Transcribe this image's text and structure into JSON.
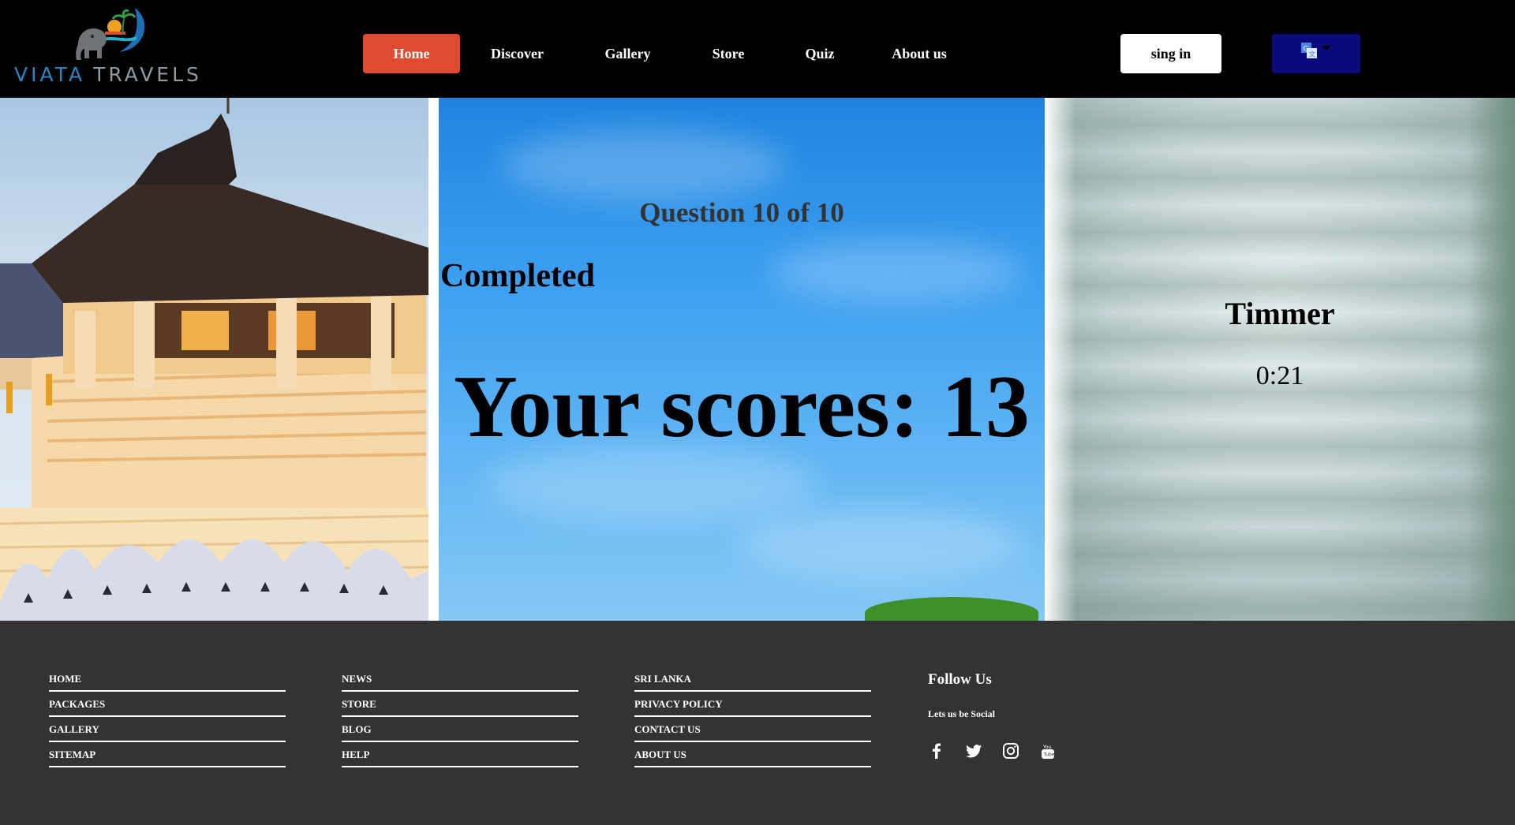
{
  "logo": {
    "word1": "VIATA",
    "word2": "TRAVELS"
  },
  "nav": {
    "items": [
      {
        "label": "Home",
        "active": true
      },
      {
        "label": "Discover",
        "active": false
      },
      {
        "label": "Gallery",
        "active": false
      },
      {
        "label": "Store",
        "active": false
      },
      {
        "label": "Quiz",
        "active": false
      },
      {
        "label": "About us",
        "active": false
      }
    ],
    "signin_label": "sing in",
    "translate_icon": "translate-icon"
  },
  "quiz": {
    "question_counter": "Question 10 of 10",
    "status": "Completed",
    "score_text": "Your scores: 13"
  },
  "timer": {
    "title": "Timmer",
    "value": "0:21"
  },
  "footer": {
    "columns": [
      {
        "links": [
          "HOME",
          "PACKAGES",
          "GALLERY",
          "SITEMAP"
        ]
      },
      {
        "links": [
          "NEWS",
          "STORE",
          "BLOG",
          "HELP"
        ]
      },
      {
        "links": [
          "SRI LANKA",
          "PRIVACY POLICY",
          "CONTACT US",
          "ABOUT US"
        ]
      }
    ],
    "follow_title": "Follow Us",
    "follow_subtitle": "Lets us be Social",
    "social_icons": [
      "facebook-icon",
      "twitter-icon",
      "instagram-icon",
      "youtube-icon"
    ]
  },
  "colors": {
    "header_bg": "#000000",
    "nav_active": "#e04a33",
    "translate_bg": "#0a0a7a",
    "footer_bg": "#333333",
    "logo_blue": "#2a84c6",
    "logo_grey": "#8f9aa2"
  }
}
